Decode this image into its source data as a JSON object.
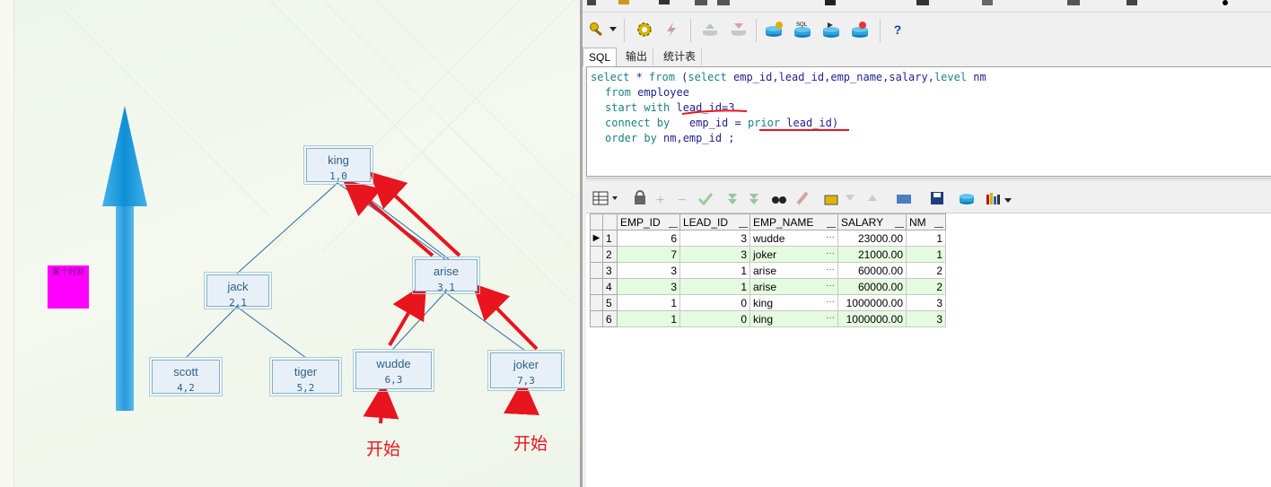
{
  "diagram": {
    "start_label_1": "开始",
    "start_label_2": "开始",
    "pink_text": "某个时刻",
    "nodes": {
      "king": {
        "name": "king",
        "value": "1,0"
      },
      "jack": {
        "name": "jack",
        "value": "2,1"
      },
      "arise": {
        "name": "arise",
        "value": "3,1"
      },
      "scott": {
        "name": "scott",
        "value": "4,2"
      },
      "tiger": {
        "name": "tiger",
        "value": "5,2"
      },
      "wudde": {
        "name": "wudde",
        "value": "6,3"
      },
      "joker": {
        "name": "joker",
        "value": "7,3"
      }
    },
    "colors": {
      "arrow": "#e8141e",
      "big_arrow": "#1a96dc",
      "node_border": "#7fb0d3",
      "node_text": "#2e5f8a"
    }
  },
  "tabs": [
    "SQL",
    "输出",
    "统计表"
  ],
  "sql": {
    "line1_kw": "select * from (select emp_id,lead_id,emp_name,salary,level nm",
    "line2": "from employee",
    "line3": "start with lead_id=3",
    "line4": "connect by   emp_id = prior lead_id)",
    "line5": "order by nm,emp_id ;"
  },
  "grid": {
    "columns": [
      "EMP_ID",
      "LEAD_ID",
      "EMP_NAME",
      "SALARY",
      "NM"
    ],
    "rows": [
      {
        "n": "1",
        "emp_id": "6",
        "lead_id": "3",
        "emp_name": "wudde",
        "salary": "23000.00",
        "nm": "1"
      },
      {
        "n": "2",
        "emp_id": "7",
        "lead_id": "3",
        "emp_name": "joker",
        "salary": "21000.00",
        "nm": "1"
      },
      {
        "n": "3",
        "emp_id": "3",
        "lead_id": "1",
        "emp_name": "arise",
        "salary": "60000.00",
        "nm": "2"
      },
      {
        "n": "4",
        "emp_id": "3",
        "lead_id": "1",
        "emp_name": "arise",
        "salary": "60000.00",
        "nm": "2"
      },
      {
        "n": "5",
        "emp_id": "1",
        "lead_id": "0",
        "emp_name": "king",
        "salary": "1000000.00",
        "nm": "3"
      },
      {
        "n": "6",
        "emp_id": "1",
        "lead_id": "0",
        "emp_name": "king",
        "salary": "1000000.00",
        "nm": "3"
      }
    ],
    "ellipsis": "···"
  },
  "toolbar_icons": [
    "key-icon",
    "gear-icon",
    "lightning-icon",
    "db-up-icon",
    "db-down-icon",
    "db-icon",
    "sql-db-icon",
    "db-run-icon",
    "db-stop-icon",
    "help-icon"
  ],
  "help_label": "?"
}
